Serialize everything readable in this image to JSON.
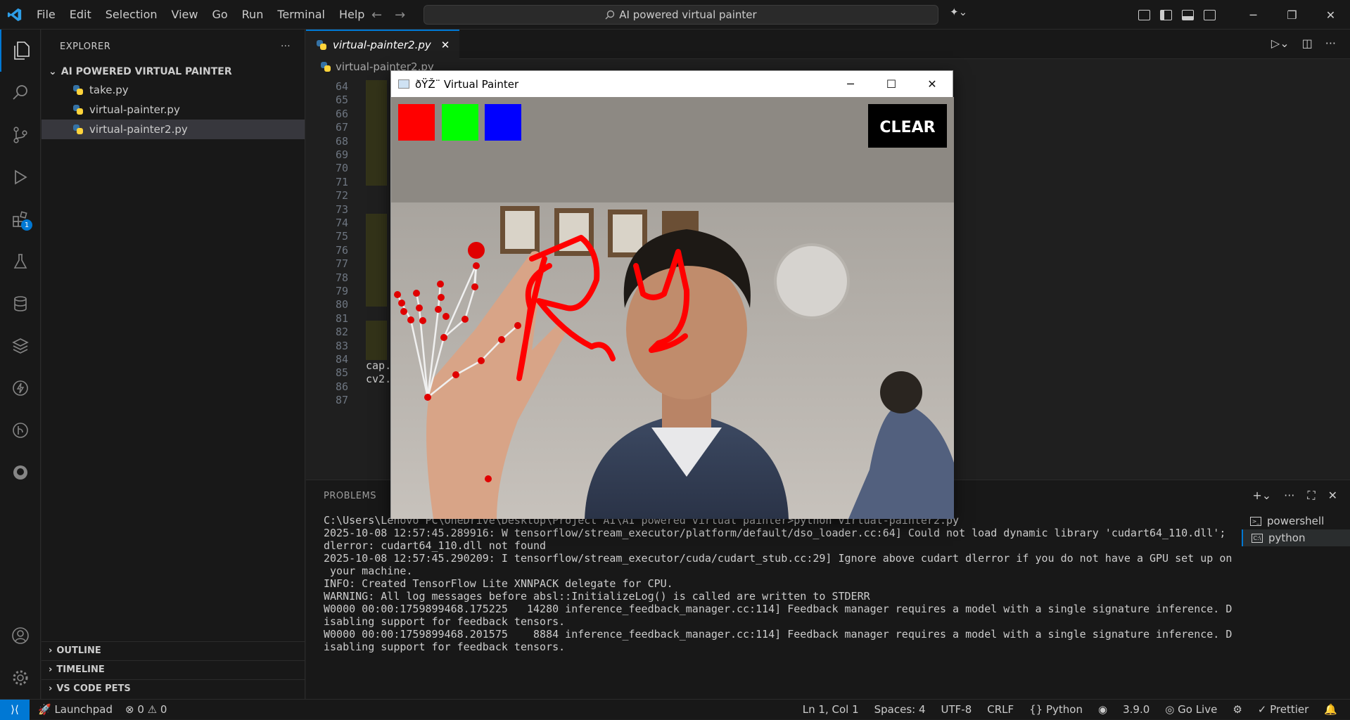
{
  "menu": [
    "File",
    "Edit",
    "Selection",
    "View",
    "Go",
    "Run",
    "Terminal",
    "Help"
  ],
  "search": "AI powered virtual painter",
  "explorer": {
    "title": "EXPLORER",
    "folder": "AI POWERED VIRTUAL PAINTER",
    "files": [
      "take.py",
      "virtual-painter.py",
      "virtual-painter2.py"
    ],
    "selected": 2,
    "sections": [
      "OUTLINE",
      "TIMELINE",
      "VS CODE PETS"
    ],
    "extensions_badge": "1"
  },
  "editor": {
    "tab": "virtual-painter2.py",
    "breadcrumb": "virtual-painter2.py",
    "line_numbers": [
      "64",
      "65",
      "66",
      "67",
      "68",
      "69",
      "70",
      "71",
      "72",
      "73",
      "74",
      "75",
      "76",
      "77",
      "78",
      "79",
      "80",
      "81",
      "82",
      "83",
      "84",
      "85",
      "86",
      "87"
    ],
    "visible_code": {
      "86": "cap.",
      "87": "cv2."
    }
  },
  "panel": {
    "title": "PROBLEMS",
    "terminal_lines": [
      "C:\\Users\\Lenovo PC\\OneDrive\\Desktop\\Project AI\\AI powered virtual painter>python virtual-painter2.py",
      "2025-10-08 12:57:45.289916: W tensorflow/stream_executor/platform/default/dso_loader.cc:64] Could not load dynamic library 'cudart64_110.dll';",
      "dlerror: cudart64_110.dll not found",
      "2025-10-08 12:57:45.290209: I tensorflow/stream_executor/cuda/cudart_stub.cc:29] Ignore above cudart dlerror if you do not have a GPU set up on",
      " your machine.",
      "INFO: Created TensorFlow Lite XNNPACK delegate for CPU.",
      "WARNING: All log messages before absl::InitializeLog() is called are written to STDERR",
      "W0000 00:00:1759899468.175225   14280 inference_feedback_manager.cc:114] Feedback manager requires a model with a single signature inference. D",
      "isabling support for feedback tensors.",
      "W0000 00:00:1759899468.201575    8884 inference_feedback_manager.cc:114] Feedback manager requires a model with a single signature inference. D",
      "isabling support for feedback tensors."
    ],
    "terminals": [
      "powershell",
      "python"
    ],
    "active_terminal": 1
  },
  "window": {
    "title": "ðŸŽ¨ Virtual Painter",
    "clear_label": "CLEAR",
    "palette": [
      "#ff0000",
      "#00ff00",
      "#0000ff"
    ]
  },
  "status": {
    "launchpad": "Launchpad",
    "errors": "0",
    "warnings": "0",
    "position": "Ln 1, Col 1",
    "spaces": "Spaces: 4",
    "encoding": "UTF-8",
    "eol": "CRLF",
    "language": "Python",
    "version": "3.9.0",
    "golive": "Go Live",
    "prettier": "Prettier"
  }
}
